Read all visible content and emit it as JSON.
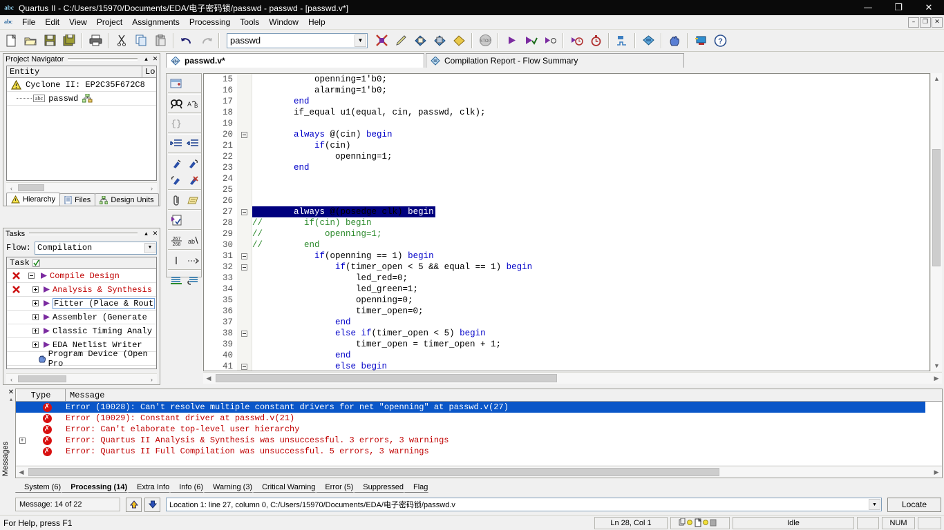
{
  "window": {
    "title": "Quartus II - C:/Users/15970/Documents/EDA/电子密码锁/passwd - passwd - [passwd.v*]",
    "app_icon": "quartus-abc-icon",
    "minimize": "—",
    "maximize": "❐",
    "close": "✕",
    "mdi_minimize": "–",
    "mdi_restore": "❐",
    "mdi_close": "✕"
  },
  "menu": {
    "items": [
      {
        "label": "File",
        "accel": "F"
      },
      {
        "label": "Edit",
        "accel": "E"
      },
      {
        "label": "View",
        "accel": "V"
      },
      {
        "label": "Project",
        "accel": "P"
      },
      {
        "label": "Assignments",
        "accel": "A"
      },
      {
        "label": "Processing",
        "accel": "P"
      },
      {
        "label": "Tools",
        "accel": "T"
      },
      {
        "label": "Window",
        "accel": "W"
      },
      {
        "label": "Help",
        "accel": "H"
      }
    ]
  },
  "toolbar": {
    "project_combo_value": "passwd",
    "buttons": [
      {
        "name": "new-file-icon",
        "glyph": "⬜"
      },
      {
        "name": "open-file-icon",
        "glyph": "📂"
      },
      {
        "name": "save-file-icon",
        "glyph": "💾"
      },
      {
        "name": "save-all-icon",
        "glyph": "🖫"
      },
      {
        "name": "print-icon",
        "glyph": "🖨"
      },
      {
        "name": "cut-icon",
        "glyph": "✂"
      },
      {
        "name": "copy-icon",
        "glyph": "⧉"
      },
      {
        "name": "paste-icon",
        "glyph": "📋"
      },
      {
        "name": "undo-icon",
        "glyph": "↶"
      },
      {
        "name": "redo-icon",
        "glyph": "↷"
      },
      {
        "name": "stop-compilation-icon",
        "glyph": "✖"
      },
      {
        "name": "edit-pencil-icon",
        "glyph": "✎"
      },
      {
        "name": "analysis-synthesis-icon",
        "glyph": "◈"
      },
      {
        "name": "fitter-icon",
        "glyph": "◈"
      },
      {
        "name": "assembler-icon",
        "glyph": "◈"
      },
      {
        "name": "stop-icon",
        "glyph": "⛔"
      },
      {
        "name": "start-compilation-icon",
        "glyph": "▶"
      },
      {
        "name": "start-analysis-elaboration-icon",
        "glyph": "▶"
      },
      {
        "name": "start-compilation-check-icon",
        "glyph": "▶"
      },
      {
        "name": "timing-analyzer-icon",
        "glyph": "⏱"
      },
      {
        "name": "classic-timing-icon",
        "glyph": "⏱"
      },
      {
        "name": "simulation-waveform-icon",
        "glyph": "⎓"
      },
      {
        "name": "compilation-report-icon",
        "glyph": "◈"
      },
      {
        "name": "programmer-icon",
        "glyph": "✋"
      },
      {
        "name": "pin-planner-icon",
        "glyph": "🖥"
      },
      {
        "name": "help-icon",
        "glyph": "?"
      }
    ]
  },
  "project_navigator": {
    "title": "Project Navigator",
    "collapse_glyph": "▴",
    "close_glyph": "✕",
    "columns": [
      "Entity",
      "Lo"
    ],
    "rows": [
      {
        "label": "Cyclone II: EP2C35F672C8",
        "icon": "device-warning-icon",
        "indent": 0
      },
      {
        "label": "passwd",
        "icon": "verilog-abc-icon",
        "indent": 1,
        "suffix_icon": "hierarchy-icon"
      }
    ],
    "tabs": [
      {
        "label": "Hierarchy",
        "icon": "hierarchy-warning-icon",
        "selected": true
      },
      {
        "label": "Files",
        "icon": "files-icon",
        "selected": false
      },
      {
        "label": "Design Units",
        "icon": "design-units-icon",
        "selected": false
      }
    ],
    "scroll_left": "‹",
    "scroll_right": "›"
  },
  "tasks": {
    "title": "Tasks",
    "collapse_glyph": "▴",
    "close_glyph": "✕",
    "flow_label": "Flow:",
    "flow_value": "Compilation",
    "column_header": "Task",
    "rows": [
      {
        "status": "error",
        "expander": "minus",
        "label": "Compile Design",
        "color": "#c00000",
        "indent": 0,
        "icon": "run-arrow-icon"
      },
      {
        "status": "error",
        "expander": "plus",
        "label": "Analysis & Synthesis",
        "color": "#c00000",
        "indent": 1,
        "icon": "run-arrow-icon"
      },
      {
        "status": "none",
        "expander": "plus",
        "label": "Fitter (Place & Rout",
        "color": "#000000",
        "indent": 1,
        "icon": "run-arrow-icon",
        "focused": true
      },
      {
        "status": "none",
        "expander": "plus",
        "label": "Assembler (Generate",
        "color": "#000000",
        "indent": 1,
        "icon": "run-arrow-icon"
      },
      {
        "status": "none",
        "expander": "plus",
        "label": "Classic Timing Analy",
        "color": "#000000",
        "indent": 1,
        "icon": "run-arrow-icon"
      },
      {
        "status": "none",
        "expander": "plus",
        "label": "EDA Netlist Writer",
        "color": "#000000",
        "indent": 1,
        "icon": "run-arrow-icon"
      },
      {
        "status": "none",
        "expander": "none",
        "label": "Program Device (Open Pro",
        "color": "#000000",
        "indent": 1,
        "icon": "program-device-icon"
      }
    ],
    "scroll_left": "‹",
    "scroll_right": "›"
  },
  "editor": {
    "tabs": [
      {
        "label": "passwd.v*",
        "icon": "verilog-file-icon",
        "active": true
      },
      {
        "label": "Compilation Report - Flow Summary",
        "icon": "report-icon",
        "active": false
      }
    ],
    "vtoolbar": [
      {
        "name": "insert-template-icon",
        "glyph": "⊞"
      },
      {
        "name": "find-icon",
        "glyph": "🔍"
      },
      {
        "name": "find-replace-icon",
        "glyph": "ab"
      },
      {
        "name": "match-brace-icon",
        "glyph": "{}"
      },
      {
        "name": "increase-indent-icon",
        "glyph": "⇥"
      },
      {
        "name": "decrease-indent-icon",
        "glyph": "⇤"
      },
      {
        "name": "bookmark-toggle-icon",
        "glyph": "⚑"
      },
      {
        "name": "bookmark-next-icon",
        "glyph": "⚑"
      },
      {
        "name": "bookmark-prev-icon",
        "glyph": "⚑"
      },
      {
        "name": "bookmark-clear-icon",
        "glyph": "⚑"
      },
      {
        "name": "attach-icon",
        "glyph": "📎"
      },
      {
        "name": "note-icon",
        "glyph": "📜"
      },
      {
        "name": "check-syntax-icon",
        "glyph": "✓"
      },
      {
        "name": "line-numbers-icon",
        "glyph": "267"
      },
      {
        "name": "word-wrap-icon",
        "glyph": "ab/"
      },
      {
        "name": "show-whitespace-icon",
        "glyph": "|"
      },
      {
        "name": "show-tabs-icon",
        "glyph": "→"
      },
      {
        "name": "comment-selection-icon",
        "glyph": "≡"
      },
      {
        "name": "uncomment-selection-icon",
        "glyph": "↩"
      }
    ],
    "first_line": 15,
    "highlighted_line": 27,
    "lines": [
      {
        "n": 15,
        "fold": false,
        "tokens": [
          {
            "t": "            openning=1'b0;",
            "c": "plain"
          }
        ]
      },
      {
        "n": 16,
        "fold": false,
        "tokens": [
          {
            "t": "            alarming=1'b0;",
            "c": "plain"
          }
        ]
      },
      {
        "n": 17,
        "fold": false,
        "tokens": [
          {
            "t": "        ",
            "c": "plain"
          },
          {
            "t": "end",
            "c": "kw"
          }
        ]
      },
      {
        "n": 18,
        "fold": false,
        "tokens": [
          {
            "t": "        if_equal u1(equal, cin, passwd, clk);",
            "c": "plain"
          }
        ]
      },
      {
        "n": 19,
        "fold": false,
        "tokens": [
          {
            "t": "",
            "c": "plain"
          }
        ]
      },
      {
        "n": 20,
        "fold": true,
        "tokens": [
          {
            "t": "        ",
            "c": "plain"
          },
          {
            "t": "always",
            "c": "kw"
          },
          {
            "t": " @(cin) ",
            "c": "plain"
          },
          {
            "t": "begin",
            "c": "kw"
          }
        ]
      },
      {
        "n": 21,
        "fold": false,
        "tokens": [
          {
            "t": "            ",
            "c": "plain"
          },
          {
            "t": "if",
            "c": "kw"
          },
          {
            "t": "(cin)",
            "c": "plain"
          }
        ]
      },
      {
        "n": 22,
        "fold": false,
        "tokens": [
          {
            "t": "                openning=1;",
            "c": "plain"
          }
        ]
      },
      {
        "n": 23,
        "fold": false,
        "tokens": [
          {
            "t": "        ",
            "c": "plain"
          },
          {
            "t": "end",
            "c": "kw"
          }
        ]
      },
      {
        "n": 24,
        "fold": false,
        "tokens": [
          {
            "t": "",
            "c": "plain"
          }
        ]
      },
      {
        "n": 25,
        "fold": false,
        "tokens": [
          {
            "t": "",
            "c": "plain"
          }
        ]
      },
      {
        "n": 26,
        "fold": false,
        "tokens": [
          {
            "t": "",
            "c": "plain"
          }
        ]
      },
      {
        "n": 27,
        "fold": true,
        "selected": true,
        "tokens": [
          {
            "t": "        ",
            "c": "plain"
          },
          {
            "t": "always",
            "c": "kw"
          },
          {
            "t": " @(posedge clk) ",
            "c": "plain"
          },
          {
            "t": "begin",
            "c": "kw"
          }
        ]
      },
      {
        "n": 28,
        "fold": false,
        "tokens": [
          {
            "t": "//        if(cin) begin",
            "c": "cmt"
          }
        ]
      },
      {
        "n": 29,
        "fold": false,
        "tokens": [
          {
            "t": "//            openning=1;",
            "c": "cmt"
          }
        ]
      },
      {
        "n": 30,
        "fold": false,
        "tokens": [
          {
            "t": "//        end",
            "c": "cmt"
          }
        ]
      },
      {
        "n": 31,
        "fold": true,
        "tokens": [
          {
            "t": "            ",
            "c": "plain"
          },
          {
            "t": "if",
            "c": "kw"
          },
          {
            "t": "(openning == 1) ",
            "c": "plain"
          },
          {
            "t": "begin",
            "c": "kw"
          }
        ]
      },
      {
        "n": 32,
        "fold": true,
        "tokens": [
          {
            "t": "                ",
            "c": "plain"
          },
          {
            "t": "if",
            "c": "kw"
          },
          {
            "t": "(timer_open < 5 && equal == 1) ",
            "c": "plain"
          },
          {
            "t": "begin",
            "c": "kw"
          }
        ]
      },
      {
        "n": 33,
        "fold": false,
        "tokens": [
          {
            "t": "                    led_red=0;",
            "c": "plain"
          }
        ]
      },
      {
        "n": 34,
        "fold": false,
        "tokens": [
          {
            "t": "                    led_green=1;",
            "c": "plain"
          }
        ]
      },
      {
        "n": 35,
        "fold": false,
        "tokens": [
          {
            "t": "                    openning=0;",
            "c": "plain"
          }
        ]
      },
      {
        "n": 36,
        "fold": false,
        "tokens": [
          {
            "t": "                    timer_open=0;",
            "c": "plain"
          }
        ]
      },
      {
        "n": 37,
        "fold": false,
        "tokens": [
          {
            "t": "                ",
            "c": "plain"
          },
          {
            "t": "end",
            "c": "kw"
          }
        ]
      },
      {
        "n": 38,
        "fold": true,
        "tokens": [
          {
            "t": "                ",
            "c": "plain"
          },
          {
            "t": "else if",
            "c": "kw"
          },
          {
            "t": "(timer_open < 5) ",
            "c": "plain"
          },
          {
            "t": "begin",
            "c": "kw"
          }
        ]
      },
      {
        "n": 39,
        "fold": false,
        "tokens": [
          {
            "t": "                    timer_open = timer_open + 1;",
            "c": "plain"
          }
        ]
      },
      {
        "n": 40,
        "fold": false,
        "tokens": [
          {
            "t": "                ",
            "c": "plain"
          },
          {
            "t": "end",
            "c": "kw"
          }
        ]
      },
      {
        "n": 41,
        "fold": true,
        "tokens": [
          {
            "t": "                ",
            "c": "plain"
          },
          {
            "t": "else begin",
            "c": "kw"
          }
        ]
      }
    ]
  },
  "messages": {
    "vertical_label": "Messages",
    "columns": [
      "Type",
      "Message"
    ],
    "rows": [
      {
        "text": "Error (10028): Can't resolve multiple constant drivers for net \"openning\" at passwd.v(27)",
        "selected": true,
        "expandable": false
      },
      {
        "text": "Error (10029): Constant driver at passwd.v(21)",
        "selected": false,
        "expandable": false
      },
      {
        "text": "Error: Can't elaborate top-level user hierarchy",
        "selected": false,
        "expandable": false
      },
      {
        "text": "Error: Quartus II Analysis & Synthesis was unsuccessful. 3 errors, 3 warnings",
        "selected": false,
        "expandable": true
      },
      {
        "text": "Error: Quartus II Full Compilation was unsuccessful. 5 errors, 3 warnings",
        "selected": false,
        "expandable": false
      }
    ],
    "tabs": [
      {
        "label": "System (6)",
        "active": false
      },
      {
        "label": "Processing (14)",
        "active": true
      },
      {
        "label": "Extra Info",
        "active": false
      },
      {
        "label": "Info (6)",
        "active": false
      },
      {
        "label": "Warning (3)",
        "active": false
      },
      {
        "label": "Critical Warning",
        "active": false
      },
      {
        "label": "Error (5)",
        "active": false
      },
      {
        "label": "Suppressed",
        "active": false
      },
      {
        "label": "Flag",
        "active": false
      }
    ],
    "counter": "Message: 14 of 22",
    "prev_glyph": "⇧",
    "next_glyph": "⇩",
    "location_value": "Location 1: line 27, column 0, C:/Users/15970/Documents/EDA/电子密码锁/passwd.v",
    "locate_button": "Locate",
    "dropdown_glyph": "▼",
    "close_glyph": "✕",
    "collapse_glyph": "▴"
  },
  "statusbar": {
    "hint": "For Help, press F1",
    "cursor": "Ln 28, Col 1",
    "state": "Idle",
    "num_lock": "NUM",
    "indicators": [
      "copy-indicator-icon",
      "page-indicator-icon"
    ]
  },
  "colors": {
    "keyword": "#0000c8",
    "comment": "#2e8b2e",
    "error_text": "#c00000",
    "selection_bg": "#00007e",
    "row_selection_bg": "#0a56c8",
    "titlebar_bg": "#0a0a0a",
    "panel_bg": "#f0f0f0"
  }
}
